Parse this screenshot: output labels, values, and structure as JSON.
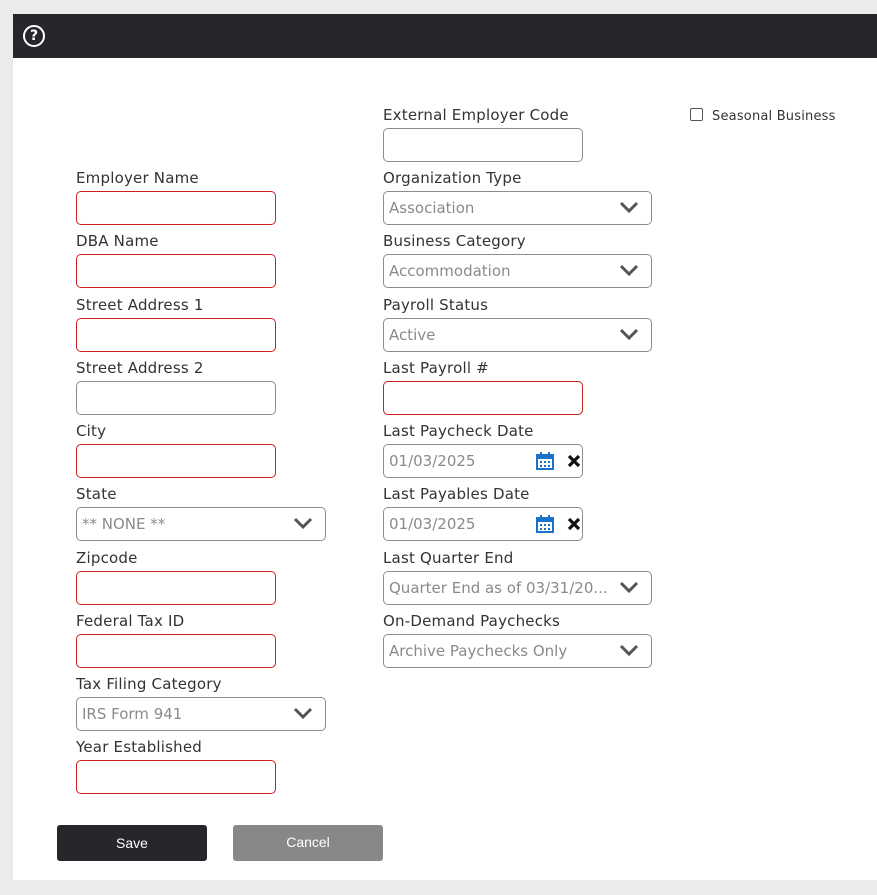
{
  "topbar": {
    "help_icon": "help-circle-icon",
    "help_glyph": "?"
  },
  "form": {
    "external_employer_code": {
      "label": "External Employer Code",
      "value": ""
    },
    "seasonal_business": {
      "label": "Seasonal Business",
      "checked": false
    },
    "employer_name": {
      "label": "Employer Name",
      "value": "",
      "required": true
    },
    "dba_name": {
      "label": "DBA Name",
      "value": "",
      "required": true
    },
    "street_address_1": {
      "label": "Street Address 1",
      "value": "",
      "required": true
    },
    "street_address_2": {
      "label": "Street Address 2",
      "value": ""
    },
    "city": {
      "label": "City",
      "value": "",
      "required": true
    },
    "state": {
      "label": "State",
      "value": "** NONE **"
    },
    "zipcode": {
      "label": "Zipcode",
      "value": "",
      "required": true
    },
    "federal_tax_id": {
      "label": "Federal Tax ID",
      "value": "",
      "required": true
    },
    "tax_filing_category": {
      "label": "Tax Filing Category",
      "value": "IRS Form 941"
    },
    "year_established": {
      "label": "Year Established",
      "value": "",
      "required": true
    },
    "organization_type": {
      "label": "Organization Type",
      "value": "Association"
    },
    "business_category": {
      "label": "Business Category",
      "value": "Accommodation"
    },
    "payroll_status": {
      "label": "Payroll Status",
      "value": "Active"
    },
    "last_payroll_number": {
      "label": "Last Payroll #",
      "value": "",
      "required": true
    },
    "last_paycheck_date": {
      "label": "Last Paycheck Date",
      "value": "01/03/2025"
    },
    "last_payables_date": {
      "label": "Last Payables Date",
      "value": "01/03/2025"
    },
    "last_quarter_end": {
      "label": "Last Quarter End",
      "value": "Quarter End as of 03/31/20..."
    },
    "on_demand_paychecks": {
      "label": "On-Demand Paychecks",
      "value": "Archive Paychecks Only"
    }
  },
  "buttons": {
    "save_label": "Save",
    "cancel_label": "Cancel"
  },
  "colors": {
    "topbar": "#25272b",
    "required_border": "#cc1f1f",
    "calendar_icon": "#1a73c9",
    "cancel_button": "#888888"
  }
}
